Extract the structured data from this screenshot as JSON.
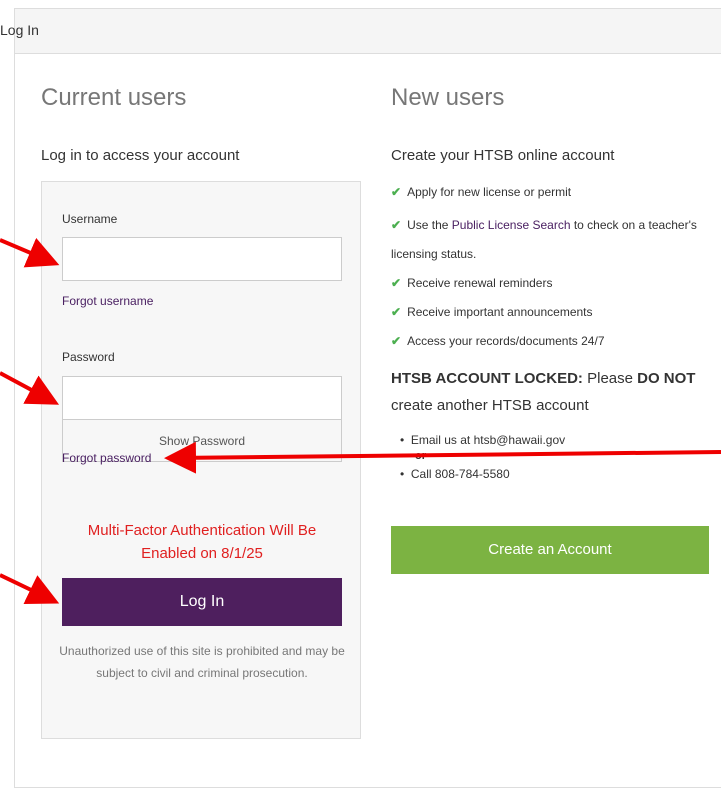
{
  "panel": {
    "title": "Log In"
  },
  "current_users": {
    "heading": "Current users",
    "subheading": "Log in to access your account",
    "username_label": "Username",
    "username_value": "",
    "forgot_username": "Forgot username",
    "password_label": "Password",
    "password_value": "",
    "show_password": "Show Password",
    "forgot_password": "Forgot password",
    "mfa_notice": "Multi-Factor Authentication Will Be Enabled on 8/1/25",
    "login_button": "Log In",
    "disclaimer": "Unauthorized use of this site is prohibited and may be subject to civil and criminal prosecution."
  },
  "new_users": {
    "heading": "New users",
    "subheading": "Create your HTSB online account",
    "benefits": [
      {
        "text": "Apply for new license or permit"
      },
      {
        "prefix": "Use the ",
        "link": "Public License Search",
        "suffix": " to check on a teacher's",
        "cont": "licensing status."
      },
      {
        "text": "Receive renewal reminders"
      },
      {
        "text": "Receive important announcements"
      },
      {
        "text": "Access your records/documents 24/7"
      }
    ],
    "locked_bold": "HTSB ACCOUNT LOCKED:",
    "locked_please": " Please ",
    "locked_do_not": "DO NOT",
    "locked_sub": "create another HTSB account",
    "contact_email": "Email us at htsb@hawaii.gov",
    "contact_or": "or",
    "contact_phone": "Call 808-784-5580",
    "create_button": "Create an Account"
  },
  "colors": {
    "login_button": "#4e1f5e",
    "create_button": "#7cb342",
    "mfa_text": "#e02020",
    "annotation_arrow": "#ee0000",
    "check": "#4caf50"
  }
}
